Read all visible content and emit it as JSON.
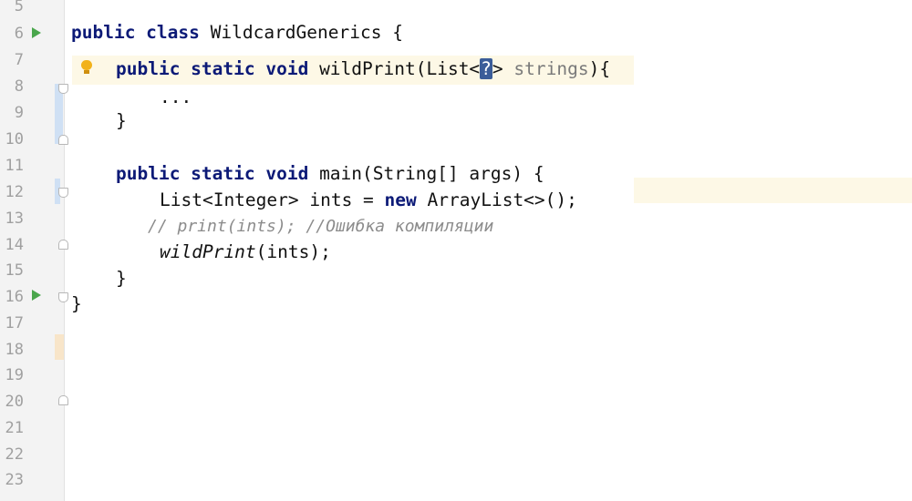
{
  "gutter": {
    "line_numbers": [
      "5",
      "6",
      "7",
      "8",
      "9",
      "10",
      "11",
      "12",
      "13",
      "14",
      "15",
      "16",
      "17",
      "18",
      "19",
      "20",
      "21",
      "22",
      "23"
    ]
  },
  "code": {
    "line6": {
      "kw": "public class",
      "rest": " WildcardGenerics {"
    },
    "line7": {
      "kw": "public static void",
      "name": " wildPrint(List<",
      "wildcard": "?",
      "gt": ">",
      "param": " strings",
      "end": "){"
    },
    "line8": {
      "text": "..."
    },
    "line9": {
      "text": "}"
    },
    "line11": {
      "kw": "public static void",
      "rest": " main(String[] args) {"
    },
    "line12": {
      "pre": "List<Integer> ints = ",
      "kw": "new",
      "rest": " ArrayList<>();"
    },
    "line13": {
      "comment": "// print(ints); //Ошибка компиляции"
    },
    "line14": {
      "call": "wildPrint",
      "rest": "(ints);"
    },
    "line15": {
      "text": "}"
    },
    "line16": {
      "text": "}"
    }
  },
  "colors": {
    "keyword": "#0c1a77",
    "comment": "#8c8c8c",
    "run_icon": "#4aa64c",
    "caret_line": "#fdf8e6",
    "wildcard_highlight": "#3b5d99"
  }
}
